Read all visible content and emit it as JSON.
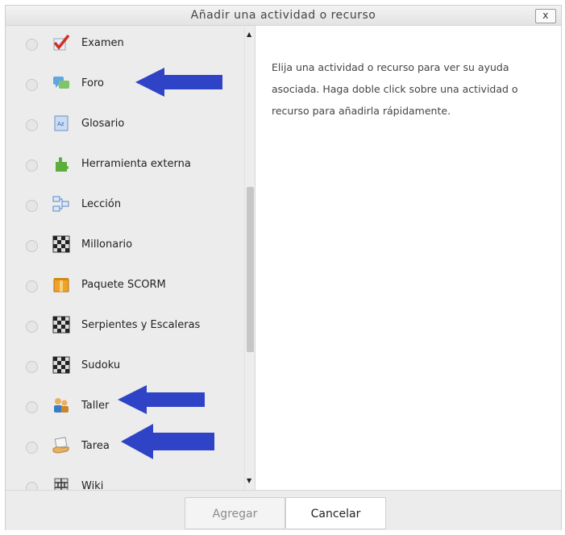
{
  "dialog": {
    "title": "Añadir una actividad o recurso",
    "close_label": "x"
  },
  "activities": [
    {
      "label": "Examen",
      "icon": "quiz-checkmark-icon"
    },
    {
      "label": "Foro",
      "icon": "forum-speech-bubbles-icon"
    },
    {
      "label": "Glosario",
      "icon": "glossary-book-icon"
    },
    {
      "label": "Herramienta externa",
      "icon": "puzzle-piece-icon"
    },
    {
      "label": "Lección",
      "icon": "lesson-flow-icon"
    },
    {
      "label": "Millonario",
      "icon": "game-board-icon"
    },
    {
      "label": "Paquete SCORM",
      "icon": "package-box-icon"
    },
    {
      "label": "Serpientes y Escaleras",
      "icon": "game-board-icon"
    },
    {
      "label": "Sudoku",
      "icon": "game-board-icon"
    },
    {
      "label": "Taller",
      "icon": "workshop-people-icon"
    },
    {
      "label": "Tarea",
      "icon": "assignment-hand-icon"
    },
    {
      "label": "Wiki",
      "icon": "wiki-tree-icon"
    }
  ],
  "help": {
    "text": "Elija una actividad o recurso para ver su ayuda asociada. Haga doble click sobre una actividad o recurso para añadirla rápidamente."
  },
  "footer": {
    "add_label": "Agregar",
    "cancel_label": "Cancelar"
  },
  "colors": {
    "arrow": "#2f43c7",
    "pane_background": "#ececec"
  }
}
